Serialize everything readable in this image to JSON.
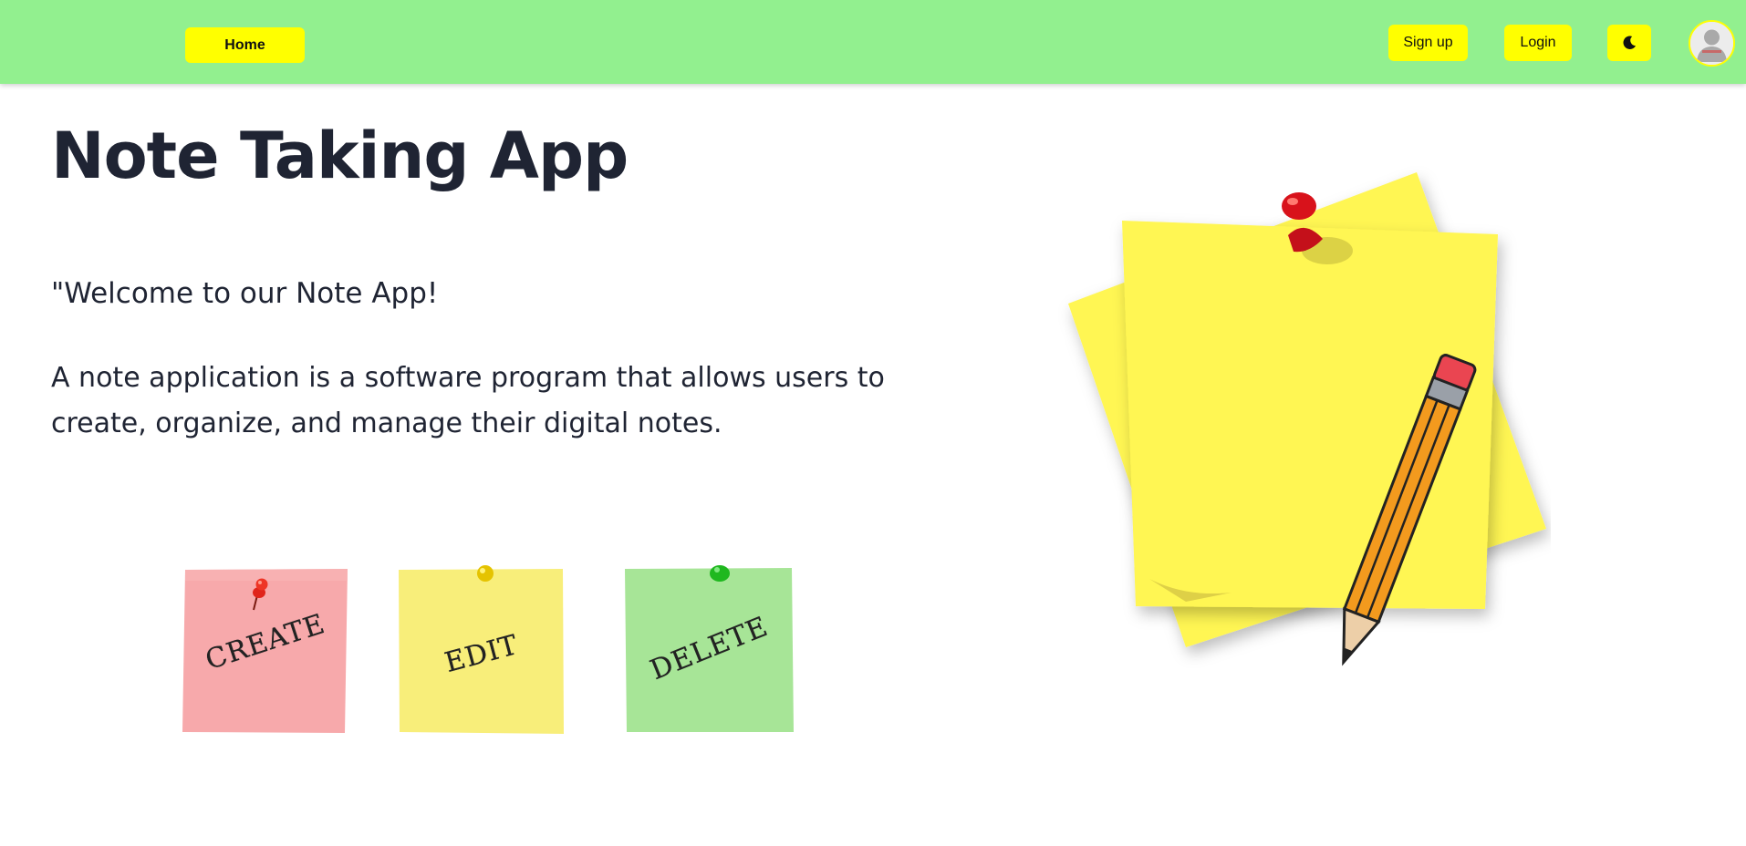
{
  "nav": {
    "home_label": "Home",
    "signup_label": "Sign up",
    "login_label": "Login",
    "theme_icon": "moon-icon",
    "avatar_icon": "user-avatar-icon",
    "colors": {
      "bar": "#92f08f",
      "button": "#ffff00"
    }
  },
  "hero": {
    "title": "Note Taking App",
    "welcome": "\"Welcome to our Note App!",
    "description": "A note application is a software program that allows users to create, organize, and manage their digital notes."
  },
  "actions": [
    {
      "label": "CREATE",
      "color": "#f7a9ab",
      "pin_color": "#e0241b",
      "icon": "red-pushpin-icon"
    },
    {
      "label": "EDIT",
      "color": "#f8ee7a",
      "pin_color": "#e5c300",
      "icon": "yellow-pushpin-icon"
    },
    {
      "label": "DELETE",
      "color": "#a7e597",
      "pin_color": "#1fb81f",
      "icon": "green-pushpin-icon"
    }
  ],
  "illustration": {
    "icon": "sticky-notes-with-pin-and-pencil-icon",
    "colors": {
      "note": "#fff652",
      "pin": "#d8121b",
      "pencil": "#f39a1e"
    }
  }
}
